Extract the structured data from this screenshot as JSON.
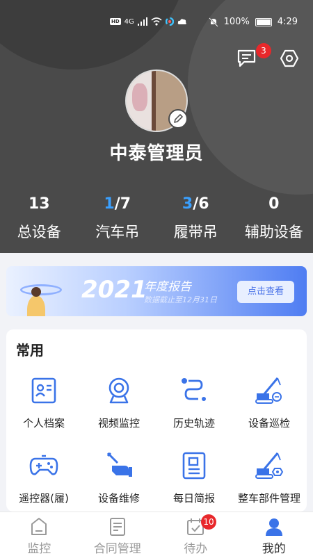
{
  "status_bar": {
    "hd": "HD",
    "network": "4G",
    "battery": "100%",
    "time": "4:29"
  },
  "header": {
    "message_badge": "3",
    "username": "中泰管理员",
    "stats": [
      {
        "num_highlight": "",
        "num_rest": "13",
        "label": "总设备"
      },
      {
        "num_highlight": "1",
        "num_rest": "/7",
        "label": "汽车吊"
      },
      {
        "num_highlight": "3",
        "num_rest": "/6",
        "label": "履带吊"
      },
      {
        "num_highlight": "",
        "num_rest": "0",
        "label": "辅助设备"
      }
    ]
  },
  "banner": {
    "year": "2021",
    "title": "年度报告",
    "subtitle": "数据截止至12月31日",
    "button": "点击查看"
  },
  "common": {
    "title": "常用",
    "items": [
      {
        "label": "个人档案",
        "icon": "profile-card-icon"
      },
      {
        "label": "视频监控",
        "icon": "webcam-icon"
      },
      {
        "label": "历史轨迹",
        "icon": "track-path-icon"
      },
      {
        "label": "设备巡检",
        "icon": "crane-inspection-icon"
      },
      {
        "label": "遥控器(履)",
        "icon": "gamepad-icon"
      },
      {
        "label": "设备维修",
        "icon": "repair-hand-icon"
      },
      {
        "label": "每日简报",
        "icon": "daily-report-icon"
      },
      {
        "label": "整车部件管理",
        "icon": "crane-parts-icon"
      }
    ]
  },
  "tabbar": {
    "tabs": [
      {
        "label": "监控",
        "icon": "monitor-icon"
      },
      {
        "label": "合同管理",
        "icon": "contract-icon"
      },
      {
        "label": "待办",
        "icon": "todo-calendar-icon",
        "badge": "10"
      },
      {
        "label": "我的",
        "icon": "user-icon"
      }
    ]
  },
  "colors": {
    "header_bg": "#4a4a4a",
    "accent_blue": "#3a73e8",
    "stat_highlight": "#3aa0ff",
    "badge_red": "#e8282b"
  }
}
